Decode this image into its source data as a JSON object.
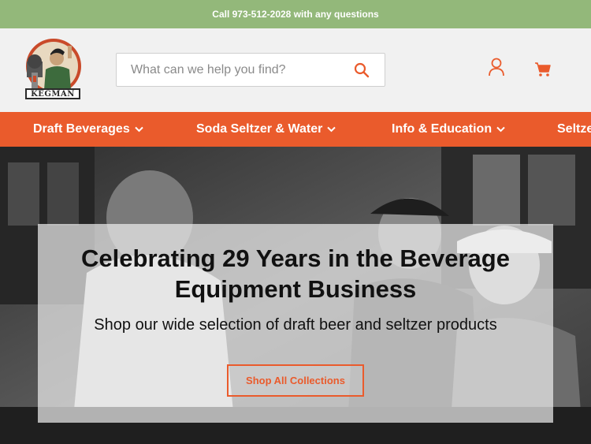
{
  "announcement": "Call 973-512-2028 with any questions",
  "logo": {
    "wordmark": "KEGMAN"
  },
  "search": {
    "placeholder": "What can we help you find?"
  },
  "colors": {
    "brand_orange": "#ea5b2c",
    "announcement_green": "#93b87a",
    "header_bg": "#f1f1f1"
  },
  "icons": {
    "search": "search-icon",
    "account": "user-icon",
    "cart": "cart-icon"
  },
  "nav": {
    "items": [
      {
        "label": "Draft Beverages"
      },
      {
        "label": "Soda Seltzer & Water"
      },
      {
        "label": "Info & Education"
      },
      {
        "label": "Seltzer"
      }
    ]
  },
  "hero": {
    "title": "Celebrating 29 Years in the Beverage Equipment Business",
    "subtitle": "Shop our wide selection of draft beer and seltzer products",
    "cta": "Shop All Collections"
  }
}
